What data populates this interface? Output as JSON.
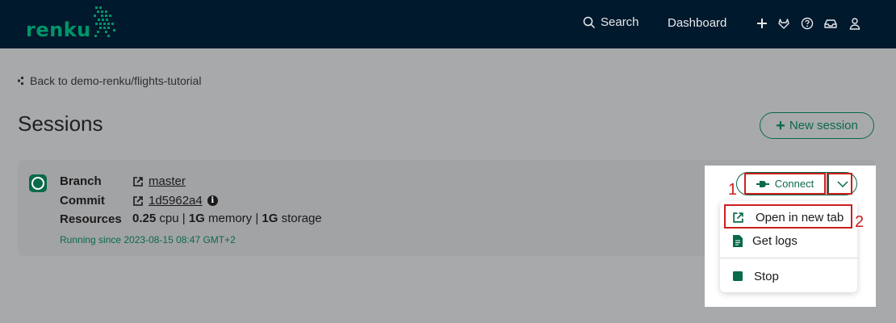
{
  "nav": {
    "logo_text": "renku",
    "search_label": "Search",
    "dashboard_label": "Dashboard",
    "icons": [
      "plus-icon",
      "gitlab-icon",
      "help-icon",
      "inbox-icon",
      "user-icon"
    ]
  },
  "page": {
    "back_label": "Back to demo-renku/flights-tutorial",
    "title": "Sessions",
    "new_session_label": "New session"
  },
  "session": {
    "branch_label": "Branch",
    "branch_value": "master",
    "commit_label": "Commit",
    "commit_value": "1d5962a4",
    "resources_label": "Resources",
    "cpu_value": "0.25",
    "cpu_unit": "cpu",
    "memory_value": "1G",
    "memory_unit": "memory",
    "storage_value": "1G",
    "storage_unit": "storage",
    "separator": "|",
    "running_text": "Running since 2023-08-15 08:47 GMT+2",
    "status": "running"
  },
  "actions": {
    "connect_label": "Connect",
    "menu": {
      "open_new_tab": "Open in new tab",
      "get_logs": "Get logs",
      "stop": "Stop"
    }
  },
  "annotations": {
    "marker_1": "1",
    "marker_2": "2"
  },
  "colors": {
    "brand_green": "#0a6a4a",
    "navbar_bg": "#01192d",
    "annotation_red": "#cc1f1f"
  }
}
